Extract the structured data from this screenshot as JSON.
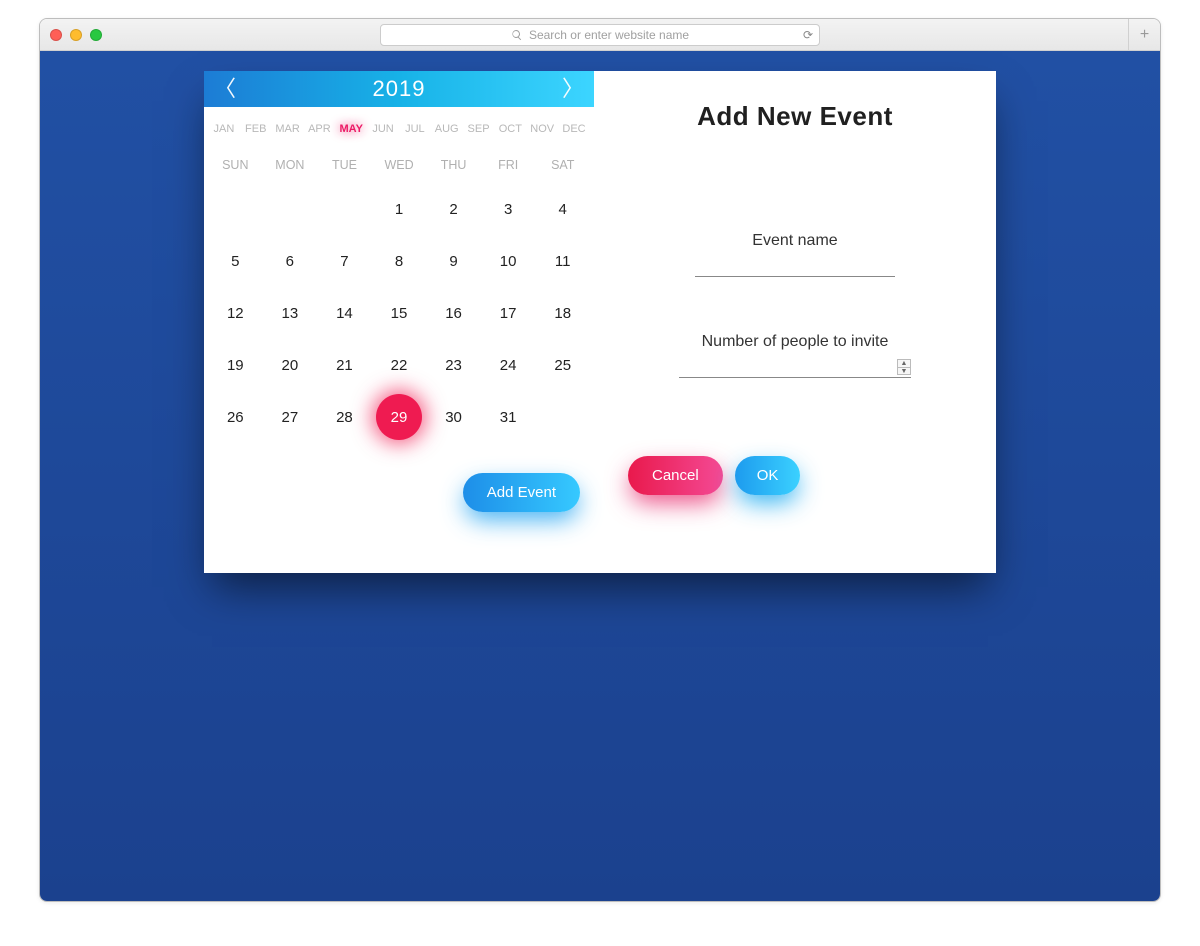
{
  "browser": {
    "placeholder": "Search or enter website name"
  },
  "calendar": {
    "prev": "〈",
    "next": "〉",
    "year": "2019",
    "months": [
      "JAN",
      "FEB",
      "MAR",
      "APR",
      "MAY",
      "JUN",
      "JUL",
      "AUG",
      "SEP",
      "OCT",
      "NOV",
      "DEC"
    ],
    "active_month_index": 4,
    "weekdays": [
      "SUN",
      "MON",
      "TUE",
      "WED",
      "THU",
      "FRI",
      "SAT"
    ],
    "leading_blank": 3,
    "days_in_month": 31,
    "today": 29,
    "add_event_label": "Add Event"
  },
  "event_form": {
    "title": "Add New Event",
    "name_label": "Event name",
    "name_value": "",
    "invite_label": "Number of people to invite",
    "invite_value": "",
    "cancel_label": "Cancel",
    "ok_label": "OK"
  },
  "colors": {
    "accent_pink": "#ef1b51",
    "accent_blue": "#1d9bee",
    "page_bg": "#1d4a99"
  }
}
